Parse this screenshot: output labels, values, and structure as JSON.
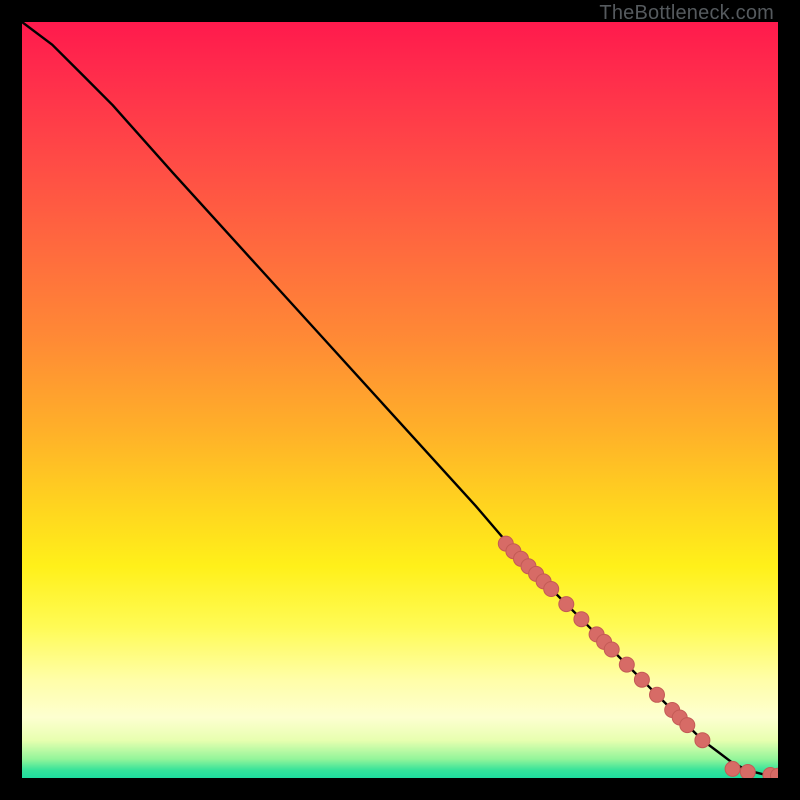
{
  "watermark": "TheBottleneck.com",
  "chart_data": {
    "type": "line",
    "title": "",
    "xlabel": "",
    "ylabel": "",
    "xlim": [
      0,
      100
    ],
    "ylim": [
      0,
      100
    ],
    "grid": false,
    "line": {
      "x": [
        0,
        4,
        8,
        12,
        20,
        30,
        40,
        50,
        60,
        66,
        70,
        74,
        78,
        82,
        86,
        88,
        90,
        92,
        94,
        96,
        98,
        100
      ],
      "y": [
        100,
        97,
        93,
        89,
        80,
        69,
        58,
        47,
        36,
        29,
        25,
        21,
        17,
        13,
        9,
        7,
        5,
        3.5,
        2,
        1,
        0.5,
        0.3
      ]
    },
    "markers": {
      "note": "scatter markers along lower-right segment of the curve",
      "x": [
        64,
        65,
        66,
        67,
        68,
        69,
        70,
        72,
        74,
        76,
        77,
        78,
        80,
        82,
        84,
        86,
        87,
        88,
        90,
        94,
        96,
        99,
        100
      ],
      "y": [
        31,
        30,
        29,
        28,
        27,
        26,
        25,
        23,
        21,
        19,
        18,
        17,
        15,
        13,
        11,
        9,
        8,
        7,
        5,
        1.2,
        0.8,
        0.4,
        0.3
      ]
    },
    "legend": null,
    "annotations": []
  },
  "colors": {
    "line": "#000000",
    "marker_fill": "#d76b66",
    "marker_stroke": "#c35a55",
    "plot_border": "#000000"
  }
}
